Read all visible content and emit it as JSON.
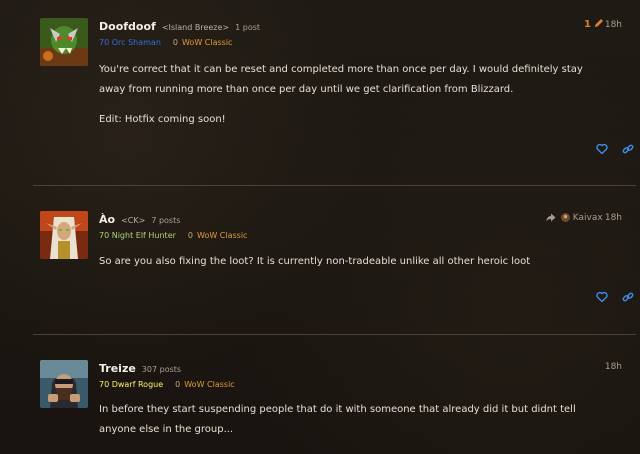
{
  "colors": {
    "background": "#1c1712",
    "accent_link": "#3d8ee8",
    "shaman": "#2e6fe0",
    "hunter": "#abd473",
    "rogue": "#fff569",
    "game": "#e19a3a",
    "edit_badge": "#e07d2c"
  },
  "posts": [
    {
      "username": "Doofdoof",
      "guild": "<Island Breeze>",
      "post_count": "1 post",
      "class_line": "70 Orc Shaman",
      "achievement": "0",
      "game": "WoW Classic",
      "edit_count": "1",
      "time": "18h",
      "paragraphs": [
        "You're correct that it can be reset and completed more than once per day. I would definitely stay away from running more than once per day until we get clarification from Blizzard.",
        "Edit: Hotfix coming soon!"
      ],
      "icons": [
        "avatar-orc",
        "pencil-icon",
        "heart-icon",
        "link-icon"
      ]
    },
    {
      "username": "Ào",
      "guild": "<CK>",
      "post_count": "7 posts",
      "class_line": "70 Night Elf Hunter",
      "achievement": "0",
      "game": "WoW Classic",
      "reply_to": "Kaivax",
      "time": "18h",
      "paragraphs": [
        "So are you also fixing the loot? It is currently non-tradeable unlike all other heroic loot"
      ],
      "icons": [
        "avatar-blood-elf",
        "reply-arrow-icon",
        "heart-icon",
        "link-icon"
      ]
    },
    {
      "username": "Treize",
      "post_count": "307 posts",
      "class_line": "70 Dwarf Rogue",
      "achievement": "0",
      "game": "WoW Classic",
      "time": "18h",
      "paragraphs": [
        "In before they start suspending people that do it with someone that already did it but didnt tell anyone else in the group..."
      ],
      "icons": [
        "avatar-dwarf"
      ]
    }
  ]
}
